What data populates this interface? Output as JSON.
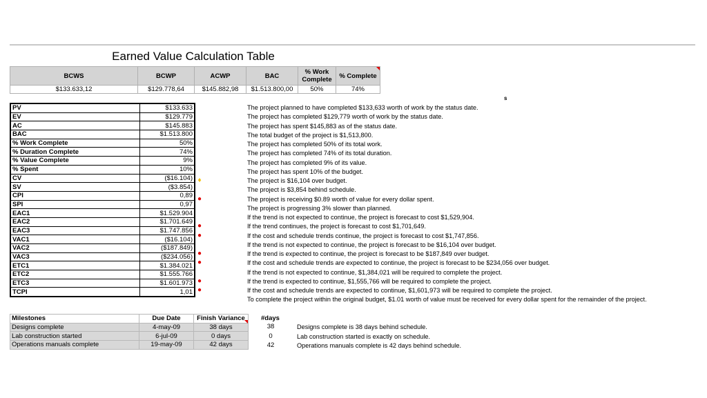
{
  "title": "Earned Value Calculation Table",
  "summary": {
    "headers": [
      "BCWS",
      "BCWP",
      "ACWP",
      "BAC",
      "% Work Complete",
      "% Complete"
    ],
    "values": [
      "$133.633,12",
      "$129.778,64",
      "$145.882,98",
      "$1.513.800,00",
      "50%",
      "74%"
    ]
  },
  "stray_text": "s",
  "colors": {
    "red_indicator": "#e00000",
    "yellow_indicator": "#f5c000",
    "header_bg": "#d4d4d4"
  },
  "metrics": [
    {
      "label": "PV",
      "value": "$133.633",
      "indicator": "",
      "desc": "The project planned to have completed $133,633 worth of work by the status date."
    },
    {
      "label": "EV",
      "value": "$129.779",
      "indicator": "",
      "desc": "The project has completed $129,779 worth of work by the status date."
    },
    {
      "label": "AC",
      "value": "$145.883",
      "indicator": "",
      "desc": "The project has spent $145,883 as of the status date."
    },
    {
      "label": "BAC",
      "value": "$1.513.800",
      "indicator": "",
      "desc": "The total budget of the project is $1,513,800."
    },
    {
      "label": "% Work Complete",
      "value": "50%",
      "indicator": "",
      "desc": "The project has completed 50% of its total work."
    },
    {
      "label": "% Duration Complete",
      "value": "74%",
      "indicator": "",
      "desc": "The project has completed 74% of its total duration."
    },
    {
      "label": "% Value Complete",
      "value": "9%",
      "indicator": "",
      "desc": "The project has completed 9% of its value."
    },
    {
      "label": "% Spent",
      "value": "10%",
      "indicator": "",
      "desc": "The project has spent 10% of the budget."
    },
    {
      "label": "CV",
      "value": "($16.104)",
      "indicator": "yellow-diamond",
      "desc": "The project is $16,104 over budget."
    },
    {
      "label": "SV",
      "value": "($3.854)",
      "indicator": "",
      "desc": "The project is $3,854 behind schedule."
    },
    {
      "label": "CPI",
      "value": "0,89",
      "indicator": "red-dot",
      "desc": "The project is receiving $0.89 worth of value for every dollar spent."
    },
    {
      "label": "SPI",
      "value": "0,97",
      "indicator": "",
      "desc": "The project is progressing 3% slower than planned."
    },
    {
      "label": "EAC1",
      "value": "$1.529.904",
      "indicator": "",
      "desc": "If the trend is not expected to continue, the project is forecast to cost $1,529,904."
    },
    {
      "label": "EAC2",
      "value": "$1.701.649",
      "indicator": "red-dot",
      "desc": "If the trend continues, the project is forecast to cost $1,701,649."
    },
    {
      "label": "EAC3",
      "value": "$1.747.856",
      "indicator": "red-dot",
      "desc": "If the cost and schedule trends continue, the project is forecast to cost $1,747,856."
    },
    {
      "label": "VAC1",
      "value": "($16.104)",
      "indicator": "",
      "desc": "If the trend is not expected to continue, the project is forecast to be $16,104 over budget."
    },
    {
      "label": "VAC2",
      "value": "($187.849)",
      "indicator": "red-dot",
      "desc": "If the trend is expected to continue, the project is forecast to be $187,849 over budget."
    },
    {
      "label": "VAC3",
      "value": "($234.056)",
      "indicator": "red-dot",
      "desc": "If the cost and schedule trends are expected to continue, the project is forecast to be $234,056 over budget."
    },
    {
      "label": "ETC1",
      "value": "$1.384.021",
      "indicator": "",
      "desc": "If the trend is not expected to continue, $1,384,021 will be required to complete the project."
    },
    {
      "label": "ETC2",
      "value": "$1.555.766",
      "indicator": "red-dot",
      "desc": "If the trend is expected to continue, $1,555,766 will be required to complete the project."
    },
    {
      "label": "ETC3",
      "value": "$1.601.973",
      "indicator": "red-dot",
      "desc": "If the cost and schedule trends are expected to continue, $1,601,973 will be required to complete the project."
    },
    {
      "label": "TCPI",
      "value": "1,01",
      "indicator": "",
      "desc": "To complete the project within the original budget, $1.01 worth of value must be received for every dollar spent for the remainder of the project."
    }
  ],
  "milestones": {
    "headers": [
      "Milestones",
      "Due Date",
      "Finish Variance"
    ],
    "days_header": "#days",
    "rows": [
      {
        "name": "Designs complete",
        "due": "4-may-09",
        "variance": "38 days",
        "days": "38",
        "desc": "Designs complete is 38 days behind schedule."
      },
      {
        "name": "Lab construction started",
        "due": "6-jul-09",
        "variance": "0 days",
        "days": "0",
        "desc": "Lab construction started is exactly on schedule."
      },
      {
        "name": "Operations manuals complete",
        "due": "19-may-09",
        "variance": "42 days",
        "days": "42",
        "desc": "Operations manuals complete is 42 days behind schedule."
      }
    ]
  }
}
